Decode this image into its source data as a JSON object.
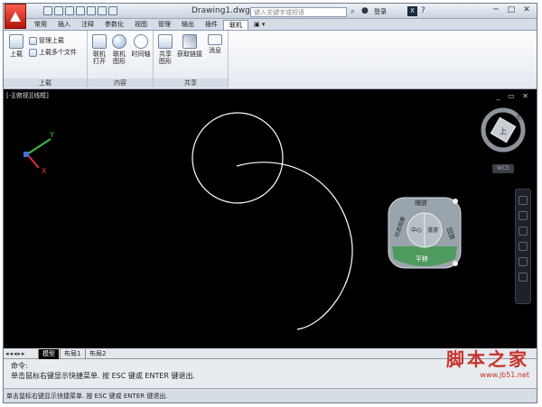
{
  "window": {
    "title": "Drawing1.dwg",
    "search_placeholder": "键入关键字或短语",
    "login": "登录",
    "x_button": "X",
    "minimize": "─",
    "maximize": "□",
    "close": "✕"
  },
  "tabs": [
    "常用",
    "插入",
    "注释",
    "参数化",
    "视图",
    "管理",
    "输出",
    "插件",
    "联机",
    "▣ ▾"
  ],
  "active_tab": "联机",
  "ribbon": {
    "upload_panel": {
      "label": "上载",
      "upload": "上载",
      "manage_upload": "管理上载",
      "upload_multiple": "上载多个文件"
    },
    "content_panel": {
      "label": "内容",
      "online_open_1": "联机",
      "online_open_2": "打开",
      "online_shape_1": "联机",
      "online_shape_2": "图形",
      "timeline": "时间轴"
    },
    "share_panel": {
      "label": "共享",
      "share_1": "共享",
      "share_2": "图形",
      "get_link": "获取链接",
      "message": "消息"
    }
  },
  "viewport": {
    "label": "[-][俯视][线框]",
    "controls": "_ ▭ ✕",
    "wcs": "WCS",
    "axis_y": "Y",
    "axis_x": "X",
    "cube_face": "上",
    "compass_n": "北",
    "wheel": {
      "top": "缩放",
      "left": "动态观察",
      "center_a": "中心",
      "center_b": "漫游",
      "right": "回放",
      "bottom": "平移"
    }
  },
  "layout_tabs": {
    "nav": "◂◂◂▸▸",
    "model": "模型",
    "layout1": "布局1",
    "layout2": "布局2"
  },
  "command": {
    "line1": "命令:",
    "line2": "单击鼠标右键显示快捷菜单. 按 ESC 键或 ENTER 键退出."
  },
  "status": "单击鼠标右键显示快捷菜单. 按 ESC 键或 ENTER 键退出.",
  "watermark": {
    "line1": "脚本之家",
    "line2": "www.jb51.net"
  }
}
